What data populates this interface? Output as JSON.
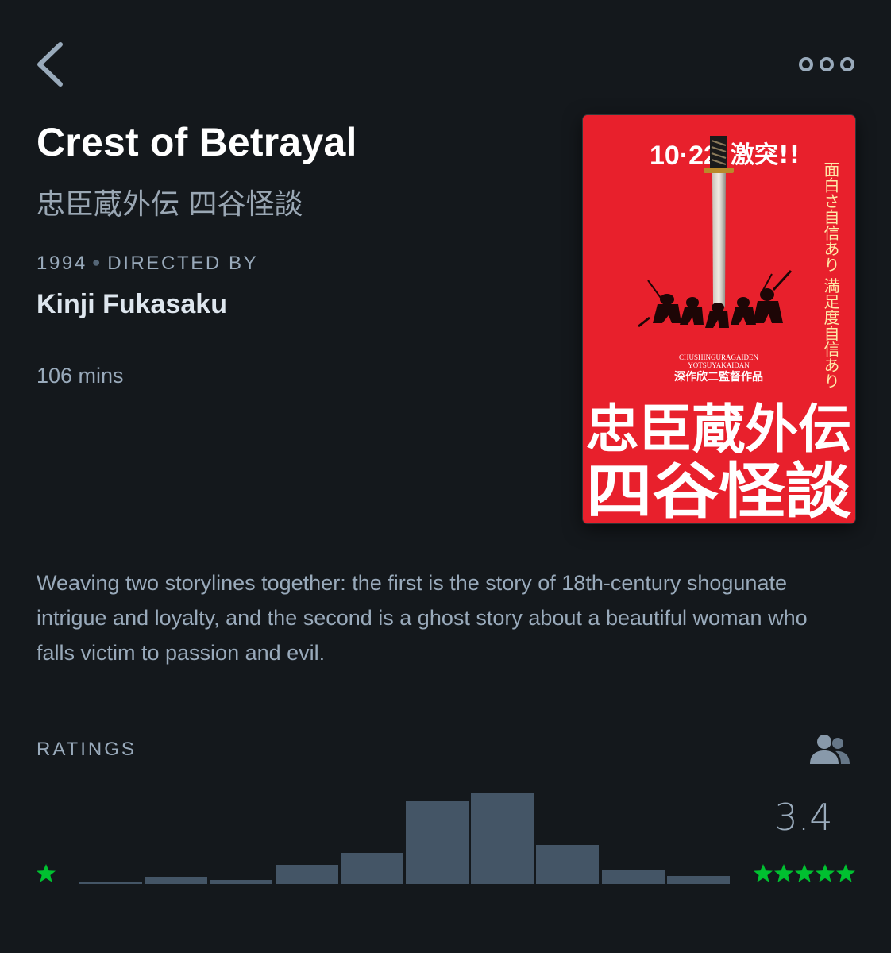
{
  "nav": {
    "back_icon": "chevron-left-icon",
    "more_icon": "more-horizontal-icon"
  },
  "film": {
    "title": "Crest of Betrayal",
    "original_title": "忠臣蔵外伝 四谷怪談",
    "year": "1994",
    "directed_by_label": "DIRECTED BY",
    "director": "Kinji Fukasaku",
    "runtime": "106 mins",
    "synopsis": "Weaving two storylines together: the first is the story of 18th-century shogunate intrigue and loyalty, and the second is a ghost story about a beautiful woman who falls victim to passion and evil."
  },
  "poster": {
    "release_date": "10·22",
    "tagline": "激突!!",
    "vertical_text": "面白さ自信あり 満足度自信あり",
    "romaji_line1": "CHUSHINGURAGAIDEN",
    "romaji_line2": "YOTSUYAKAIDAN",
    "credit": "深作欣二監督作品",
    "title_line1": "忠臣蔵外伝",
    "title_line2": "四谷怪談",
    "colors": {
      "background": "#e8202c",
      "text": "#ffffff",
      "vertical_text": "#ffe9a8"
    }
  },
  "ratings": {
    "heading": "RATINGS",
    "friends_icon": "friends-icon",
    "average": "3.4",
    "min_label_icon": "star-icon",
    "max_label_icon": "five-stars-icon",
    "histogram": [
      0.03,
      0.08,
      0.04,
      0.21,
      0.34,
      0.91,
      1.0,
      0.43,
      0.16,
      0.09
    ],
    "colors": {
      "bar": "#445566",
      "star": "#00c030"
    }
  }
}
